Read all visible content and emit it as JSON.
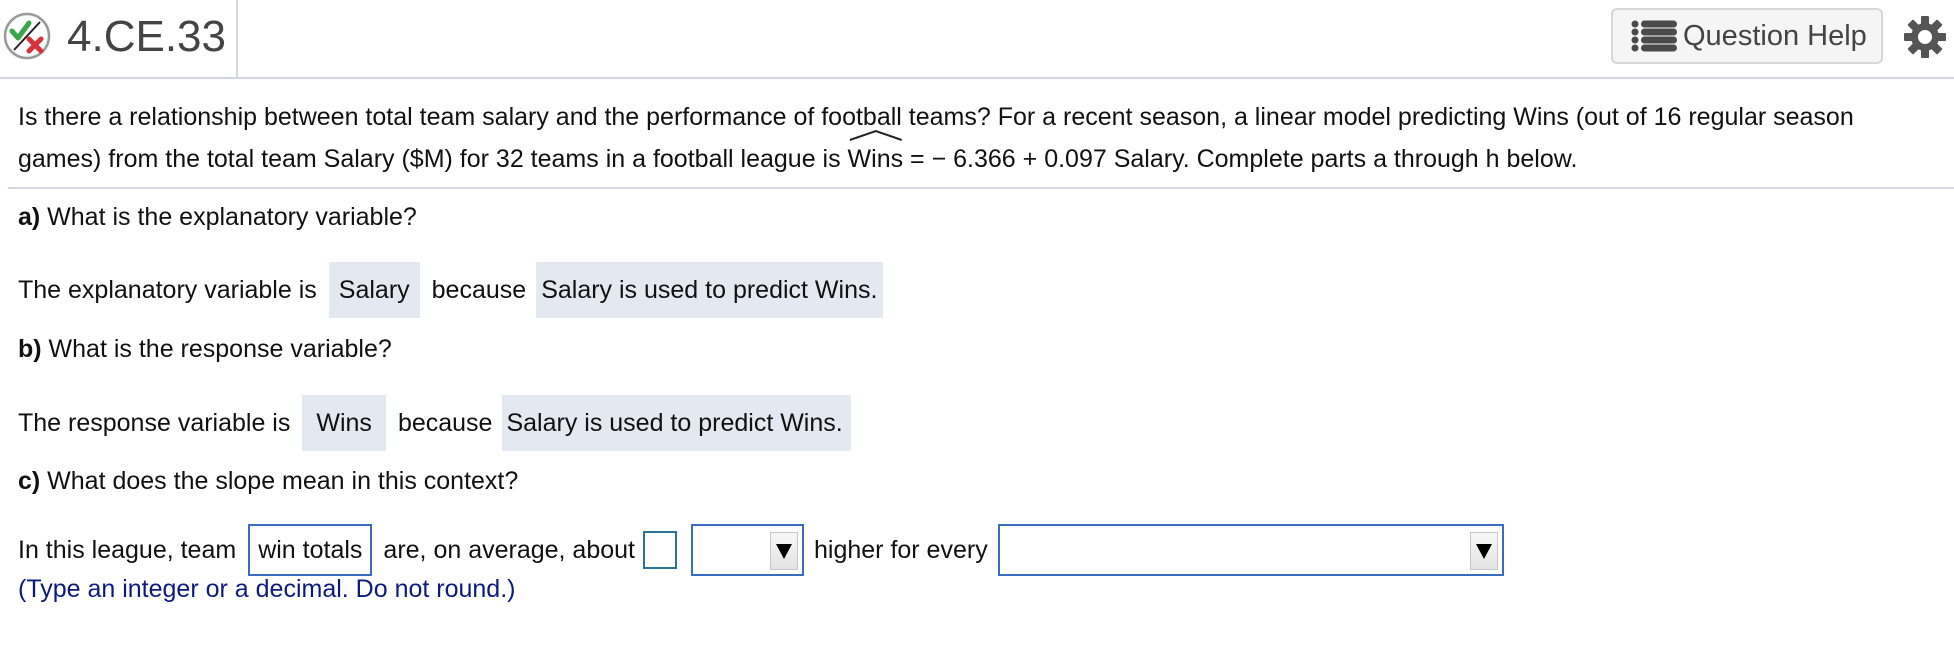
{
  "header": {
    "question_id": "4.CE.33",
    "status_icon": "partial-correct-icon",
    "help_button_label": "Question Help",
    "help_icon": "list-icon",
    "settings_icon": "gear-icon"
  },
  "question": {
    "line1": "Is there a relationship between total team salary and the performance of football teams? For a recent season, a linear model predicting Wins (out of 16 regular season",
    "line2_prefix": "games) from the total team Salary ($M) for 32 teams in a football league is ",
    "hat_var": "Wins",
    "line2_suffix": " =  − 6.366 + 0.097 Salary. Complete parts a through h below."
  },
  "parts": {
    "a": {
      "letter": "a)",
      "question": " What is the explanatory variable?",
      "prefix": "The explanatory variable is",
      "answer1": "Salary",
      "middle": "because",
      "answer2": "Salary is used to predict Wins."
    },
    "b": {
      "letter": "b)",
      "question": " What is the response variable?",
      "prefix": "The response variable is",
      "answer1": "Wins",
      "middle": "because",
      "answer2": "Salary is used to predict Wins."
    },
    "c": {
      "letter": "c)",
      "question": " What does the slope mean in this context?",
      "prefix": "In this league, team",
      "selected_answer": "win totals",
      "middle": "are, on average, about",
      "number_input_value": "",
      "unit_dropdown_value": "",
      "after_dropdown": "higher for every",
      "every_dropdown_value": "",
      "hint": "(Type an integer or a decimal. Do not round.)"
    }
  },
  "colors": {
    "answer_bg": "#e4e8f1",
    "input_border": "#3a6cc4",
    "hint_text": "#0d1b7e",
    "divider": "#d3d7e1"
  }
}
